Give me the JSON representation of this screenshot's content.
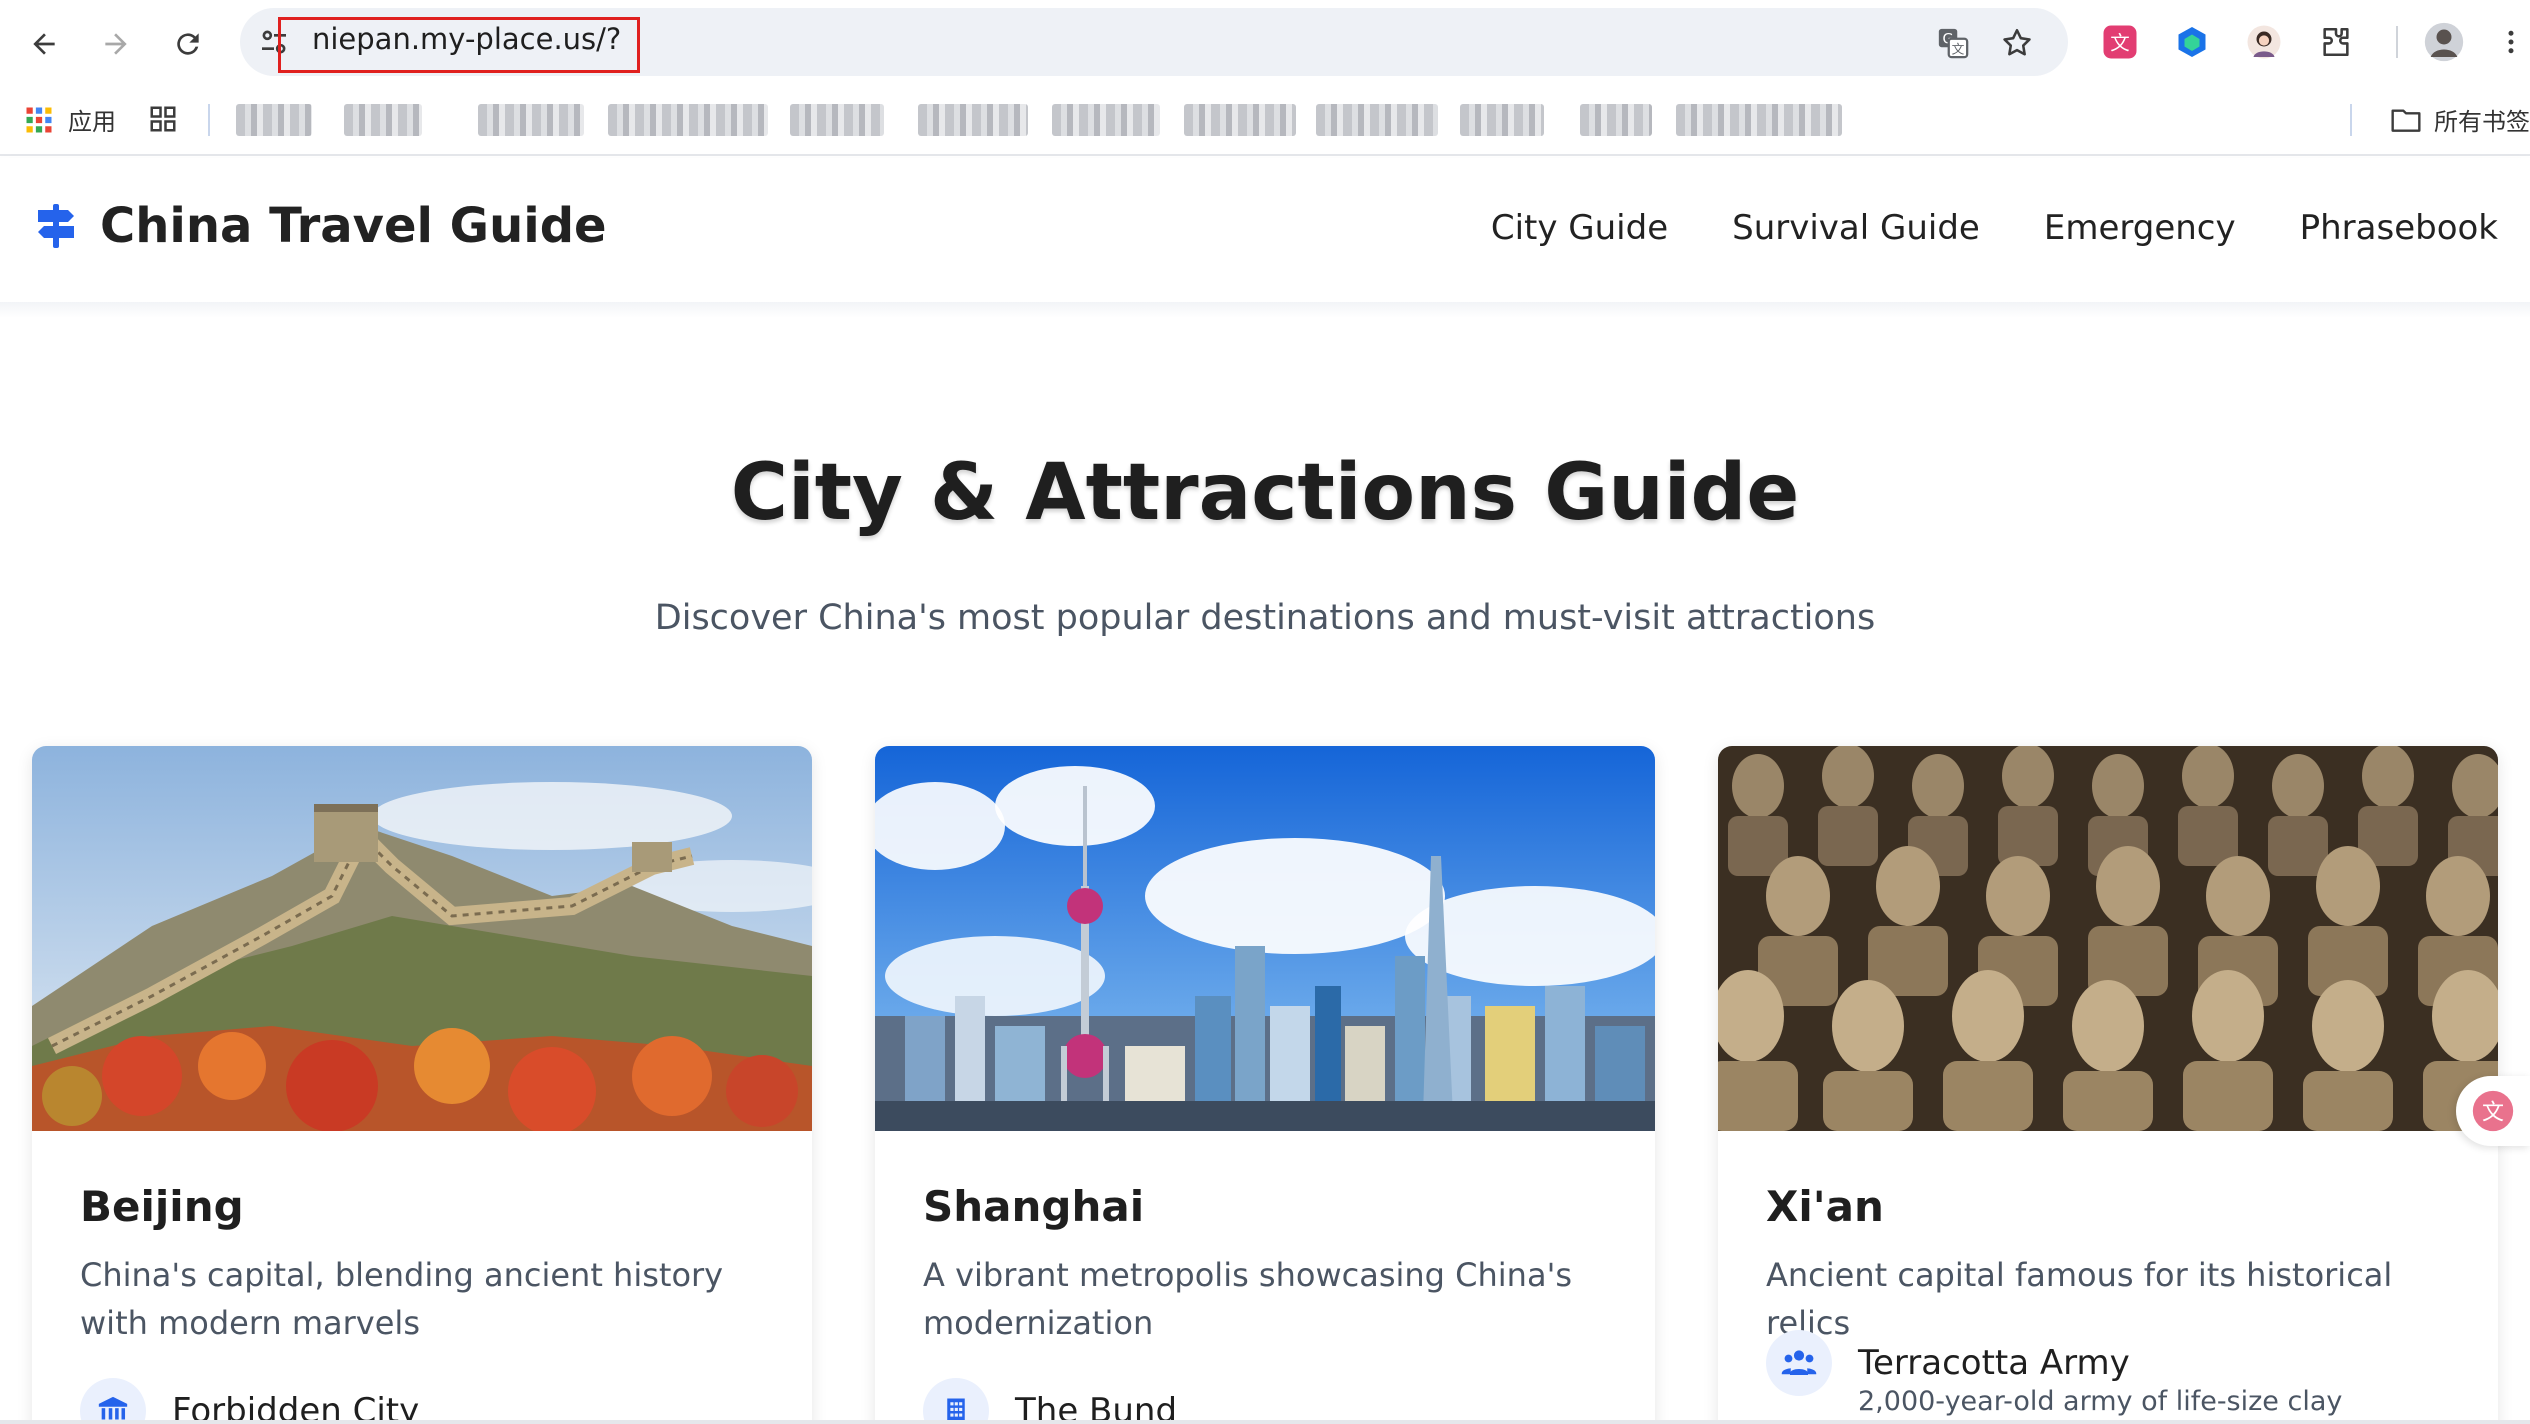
{
  "browser": {
    "url": "niepan.my-place.us/?",
    "bookmarks": {
      "apps_label": "应用",
      "all_bookmarks_label": "所有书签"
    }
  },
  "header": {
    "brand": "China Travel Guide",
    "nav": [
      "City Guide",
      "Survival Guide",
      "Emergency",
      "Phrasebook"
    ]
  },
  "hero": {
    "title": "City & Attractions Guide",
    "subtitle": "Discover China's most popular destinations and must-visit attractions"
  },
  "cities": [
    {
      "name": "Beijing",
      "description": "China's capital, blending ancient history with modern marvels",
      "attraction": {
        "name": "Forbidden City",
        "icon": "landmark-icon",
        "detail": ""
      }
    },
    {
      "name": "Shanghai",
      "description": "A vibrant metropolis showcasing China's modernization",
      "attraction": {
        "name": "The Bund",
        "icon": "building-icon",
        "detail": ""
      }
    },
    {
      "name": "Xi'an",
      "description": "Ancient capital famous for its historical relics",
      "attraction": {
        "name": "Terracotta Army",
        "icon": "users-icon",
        "detail": "2,000-year-old army of life-size clay"
      }
    }
  ],
  "colors": {
    "accent": "#2563eb",
    "icon_bg": "#eaf0fd",
    "url_highlight": "#e0201f"
  }
}
